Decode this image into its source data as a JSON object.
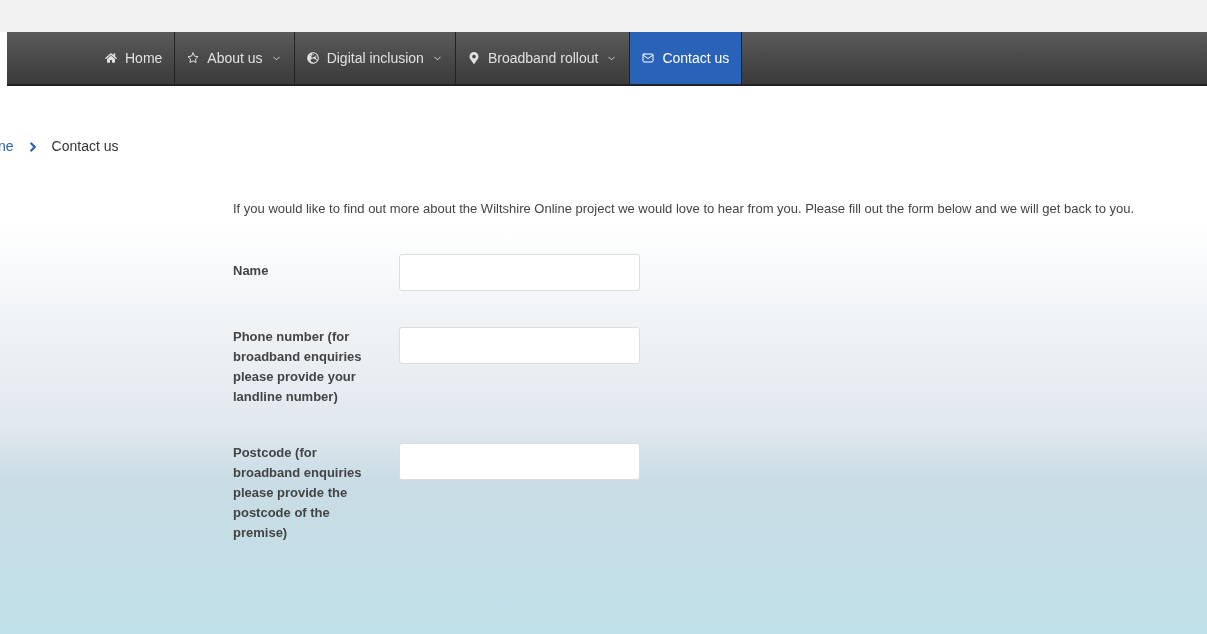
{
  "nav": [
    {
      "label": "Home",
      "dropdown": false,
      "selected": false
    },
    {
      "label": "About us",
      "dropdown": true,
      "selected": false
    },
    {
      "label": "Digital inclusion",
      "dropdown": true,
      "selected": false
    },
    {
      "label": "Broadband rollout",
      "dropdown": true,
      "selected": false
    },
    {
      "label": "Contact us",
      "dropdown": false,
      "selected": true
    }
  ],
  "breadcrumb": {
    "link": "ne",
    "current": "Contact us"
  },
  "intro": "If you would like to find out more about the Wiltshire Online project we would love to hear from you. Please fill out the form below and we will get back to you.",
  "fields": [
    {
      "label": "Name"
    },
    {
      "label": "Phone number (for broadband enquiries please provide your landline number)"
    },
    {
      "label": "Postcode (for broadband enquiries please provide the postcode of the premise)"
    }
  ]
}
